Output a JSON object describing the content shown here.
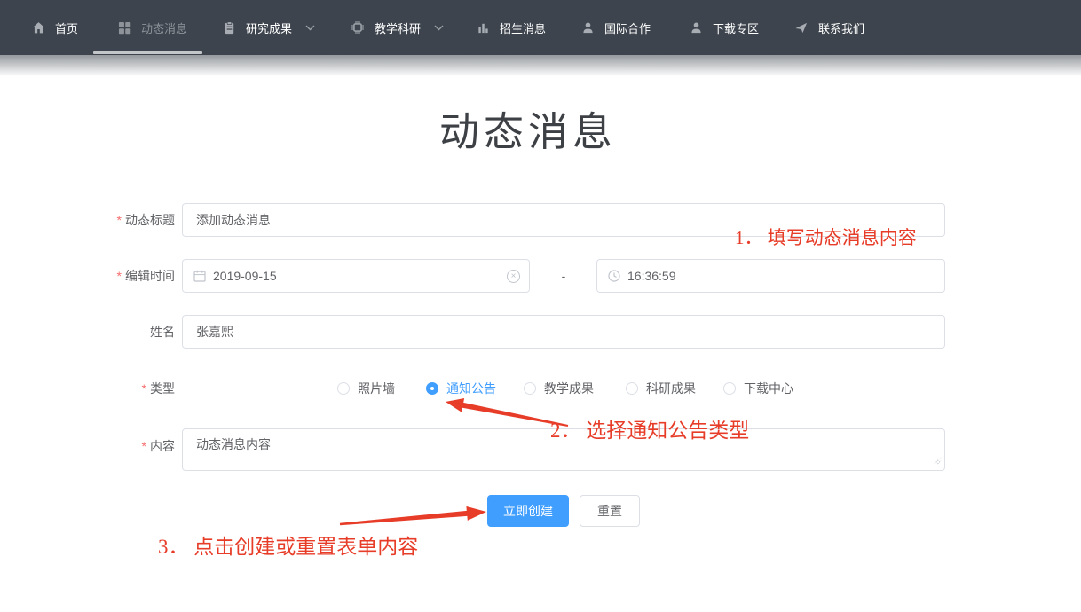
{
  "nav": {
    "items": [
      {
        "label": "首页",
        "icon": "home",
        "active": false,
        "has_dropdown": false
      },
      {
        "label": "动态消息",
        "icon": "grid",
        "active": true,
        "has_dropdown": false
      },
      {
        "label": "研究成果",
        "icon": "clipboard",
        "active": false,
        "has_dropdown": true
      },
      {
        "label": "教学科研",
        "icon": "chip",
        "active": false,
        "has_dropdown": true
      },
      {
        "label": "招生消息",
        "icon": "bar-chart",
        "active": false,
        "has_dropdown": false
      },
      {
        "label": "国际合作",
        "icon": "person",
        "active": false,
        "has_dropdown": false
      },
      {
        "label": "下载专区",
        "icon": "person",
        "active": false,
        "has_dropdown": false
      },
      {
        "label": "联系我们",
        "icon": "send",
        "active": false,
        "has_dropdown": false
      }
    ]
  },
  "page": {
    "title": "动态消息"
  },
  "form": {
    "required_mark": "*",
    "title_field": {
      "label": "动态标题",
      "required": true,
      "value": "添加动态消息"
    },
    "time_field": {
      "label": "编辑时间",
      "required": true,
      "date": "2019-09-15",
      "separator": "-",
      "time": "16:36:59"
    },
    "name_field": {
      "label": "姓名",
      "required": false,
      "value": "张嘉熙"
    },
    "type_field": {
      "label": "类型",
      "required": true,
      "selected": "通知公告",
      "options": [
        {
          "label": "照片墙",
          "selected": false
        },
        {
          "label": "通知公告",
          "selected": true
        },
        {
          "label": "教学成果",
          "selected": false
        },
        {
          "label": "科研成果",
          "selected": false
        },
        {
          "label": "下载中心",
          "selected": false
        }
      ]
    },
    "content_field": {
      "label": "内容",
      "required": true,
      "value": "动态消息内容"
    },
    "buttons": {
      "create": "立即创建",
      "reset": "重置"
    }
  },
  "annotations": {
    "step1": "1． 填写动态消息内容",
    "step2": "2． 选择通知公告类型",
    "step3": "3． 点击创建或重置表单内容"
  },
  "colors": {
    "primary": "#409EFF",
    "navbar_bg": "#3d444d",
    "annotation_red": "#e73c28",
    "required_red": "#f56c6c",
    "input_border": "#dcdfe6"
  }
}
